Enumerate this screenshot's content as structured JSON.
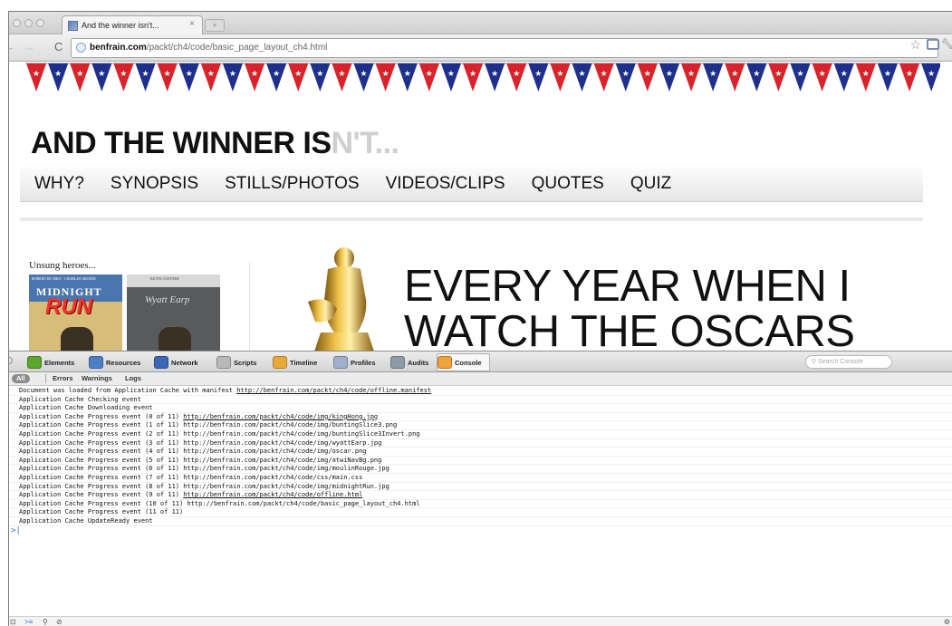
{
  "window": {
    "tab_title": "And the winner isn't...",
    "tab_close": "×"
  },
  "address_bar": {
    "host": "benfrain.com",
    "path": "/packt/ch4/code/basic_page_layout_ch4.html"
  },
  "page": {
    "title_main": "AND THE WINNER IS",
    "title_faded": "N'T...",
    "nav": [
      "WHY?",
      "SYNOPSIS",
      "STILLS/PHOTOS",
      "VIDEOS/CLIPS",
      "QUOTES",
      "QUIZ"
    ],
    "sidebar_heading": "Unsung heroes...",
    "poster1": {
      "cast": "ROBERT DE NIRO · CHARLES GRODIN",
      "title_top": "MIDNIGHT",
      "title_bottom": "RUN"
    },
    "poster2": {
      "cast": "KEVIN COSTNER",
      "title": "Wyatt Earp"
    },
    "headline_line1": "EVERY YEAR WHEN I",
    "headline_line2": "WATCH THE OSCARS"
  },
  "devtools": {
    "tabs": [
      {
        "label": "Elements",
        "icon": "elements-icon",
        "color": "#5ba62c"
      },
      {
        "label": "Resources",
        "icon": "resources-icon",
        "color": "#4e7fc5"
      },
      {
        "label": "Network",
        "icon": "network-icon",
        "color": "#3a66b3"
      },
      {
        "label": "Scripts",
        "icon": "scripts-icon",
        "color": "#b9b9b9"
      },
      {
        "label": "Timeline",
        "icon": "timeline-icon",
        "color": "#e7a93a"
      },
      {
        "label": "Profiles",
        "icon": "profiles-icon",
        "color": "#9fb0c8"
      },
      {
        "label": "Audits",
        "icon": "audits-icon",
        "color": "#8e9aa8"
      },
      {
        "label": "Console",
        "icon": "console-icon",
        "color": "#f2a23a"
      }
    ],
    "active_tab": "Console",
    "search_placeholder": "Search Console",
    "filters": [
      "All",
      "Errors",
      "Warnings",
      "Logs"
    ],
    "console_lines": [
      {
        "text": "Document was loaded from Application Cache with manifest ",
        "url": "http://benfrain.com/packt/ch4/code/offline.manifest",
        "linked": true
      },
      {
        "text": "Application Cache Checking event",
        "url": "",
        "linked": false
      },
      {
        "text": "Application Cache Downloading event",
        "url": "",
        "linked": false
      },
      {
        "text": "Application Cache Progress event (0 of 11) ",
        "url": "http://benfrain.com/packt/ch4/code/img/kingHong.jpg",
        "linked": true
      },
      {
        "text": "Application Cache Progress event (1 of 11) ",
        "url": "http://benfrain.com/packt/ch4/code/img/buntingSlice3.png",
        "linked": false
      },
      {
        "text": "Application Cache Progress event (2 of 11) ",
        "url": "http://benfrain.com/packt/ch4/code/img/buntingSlice3Invert.png",
        "linked": false
      },
      {
        "text": "Application Cache Progress event (3 of 11) ",
        "url": "http://benfrain.com/packt/ch4/code/img/wyattEarp.jpg",
        "linked": false
      },
      {
        "text": "Application Cache Progress event (4 of 11) ",
        "url": "http://benfrain.com/packt/ch4/code/img/oscar.png",
        "linked": false
      },
      {
        "text": "Application Cache Progress event (5 of 11) ",
        "url": "http://benfrain.com/packt/ch4/code/img/atwiNavBg.png",
        "linked": false
      },
      {
        "text": "Application Cache Progress event (6 of 11) ",
        "url": "http://benfrain.com/packt/ch4/code/img/moulinRouge.jpg",
        "linked": false
      },
      {
        "text": "Application Cache Progress event (7 of 11) ",
        "url": "http://benfrain.com/packt/ch4/code/css/main.css",
        "linked": false
      },
      {
        "text": "Application Cache Progress event (8 of 11) ",
        "url": "http://benfrain.com/packt/ch4/code/img/midnightRun.jpg",
        "linked": false
      },
      {
        "text": "Application Cache Progress event (9 of 11) ",
        "url": "http://benfrain.com/packt/ch4/code/offline.html",
        "linked": true
      },
      {
        "text": "Application Cache Progress event (10 of 11) ",
        "url": "http://benfrain.com/packt/ch4/code/basic_page_layout_ch4.html",
        "linked": false
      },
      {
        "text": "Application Cache Progress event (11 of 11)",
        "url": "",
        "linked": false
      },
      {
        "text": "Application Cache UpdateReady event",
        "url": "",
        "linked": false
      }
    ],
    "prompt": ">|"
  },
  "colors": {
    "bunting_red": "#d8232a",
    "bunting_blue": "#1f2f8c",
    "link": "#111111"
  }
}
